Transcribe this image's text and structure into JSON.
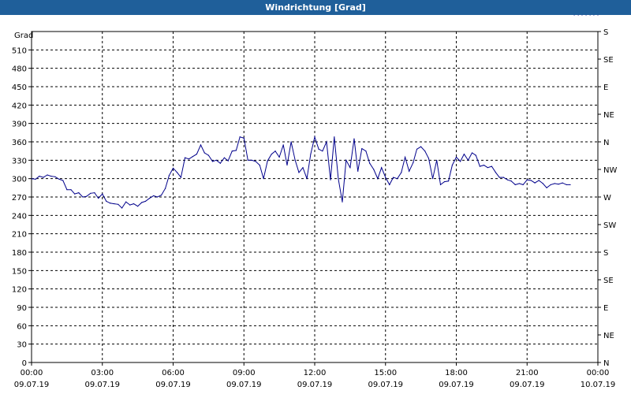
{
  "window": {
    "title": "Windrichtung [Grad]"
  },
  "chart_data": {
    "type": "line",
    "title": "Windrichtung [Grad]",
    "ylabel": "Grad",
    "ylim": [
      0,
      540
    ],
    "y_ticks": [
      0,
      30,
      60,
      90,
      120,
      150,
      180,
      210,
      240,
      270,
      300,
      330,
      360,
      390,
      420,
      450,
      480,
      510
    ],
    "y2_ticks": [
      {
        "value": 0,
        "label": "N"
      },
      {
        "value": 45,
        "label": "NE"
      },
      {
        "value": 90,
        "label": "E"
      },
      {
        "value": 135,
        "label": "SE"
      },
      {
        "value": 180,
        "label": "S"
      },
      {
        "value": 225,
        "label": "SW"
      },
      {
        "value": 270,
        "label": "W"
      },
      {
        "value": 315,
        "label": "NW"
      },
      {
        "value": 360,
        "label": "N"
      },
      {
        "value": 405,
        "label": "NE"
      },
      {
        "value": 450,
        "label": "E"
      },
      {
        "value": 495,
        "label": "SE"
      },
      {
        "value": 540,
        "label": "S"
      }
    ],
    "x_ticks": [
      {
        "time": "00:00",
        "date": "09.07.19"
      },
      {
        "time": "03:00",
        "date": "09.07.19"
      },
      {
        "time": "06:00",
        "date": "09.07.19"
      },
      {
        "time": "09:00",
        "date": "09.07.19"
      },
      {
        "time": "12:00",
        "date": "09.07.19"
      },
      {
        "time": "15:00",
        "date": "09.07.19"
      },
      {
        "time": "18:00",
        "date": "09.07.19"
      },
      {
        "time": "21:00",
        "date": "09.07.19"
      },
      {
        "time": "00:00",
        "date": "10.07.19"
      }
    ],
    "grid": true,
    "line_color": "#00008b",
    "series": [
      {
        "x_hours": [
          0,
          0.17,
          0.33,
          0.5,
          0.67,
          0.83,
          1,
          1.17,
          1.33,
          1.5,
          1.67,
          1.83,
          2,
          2.17,
          2.33,
          2.5,
          2.67,
          2.83,
          3,
          3.17,
          3.33,
          3.5,
          3.67,
          3.83,
          4,
          4.17,
          4.33,
          4.5,
          4.67,
          4.83,
          5,
          5.17,
          5.33,
          5.5,
          5.67,
          5.83,
          6,
          6.17,
          6.33,
          6.5,
          6.67,
          6.83,
          7,
          7.17,
          7.33,
          7.5,
          7.67,
          7.83,
          8,
          8.17,
          8.33,
          8.5,
          8.67,
          8.83,
          9,
          9.17,
          9.33,
          9.5,
          9.67,
          9.83,
          10,
          10.17,
          10.33,
          10.5,
          10.67,
          10.83,
          11,
          11.17,
          11.33,
          11.5,
          11.67,
          11.83,
          12,
          12.17,
          12.33,
          12.5,
          12.67,
          12.83,
          13,
          13.17,
          13.33,
          13.5,
          13.67,
          13.83,
          14,
          14.17,
          14.33,
          14.5,
          14.67,
          14.83,
          15,
          15.17,
          15.33,
          15.5,
          15.67,
          15.83,
          16,
          16.17,
          16.33,
          16.5,
          16.67,
          16.83,
          17,
          17.17,
          17.33,
          17.5,
          17.67,
          17.83,
          18,
          18.17,
          18.33,
          18.5,
          18.67,
          18.83,
          19,
          19.17,
          19.33,
          19.5,
          19.67,
          19.83,
          20,
          20.17,
          20.33,
          20.5,
          20.67,
          20.83,
          21,
          21.17,
          21.33,
          21.5,
          21.67,
          21.83,
          22,
          22.17,
          22.33,
          22.5,
          22.67,
          22.83,
          23,
          23.17,
          23.33,
          23.5,
          23.67,
          23.83,
          24
        ],
        "values": [
          300,
          299,
          304,
          302,
          306,
          304,
          303,
          299,
          297,
          282,
          282,
          275,
          277,
          270,
          271,
          276,
          277,
          268,
          275,
          263,
          260,
          259,
          258,
          252,
          262,
          257,
          259,
          255,
          261,
          263,
          268,
          272,
          270,
          273,
          284,
          305,
          317,
          310,
          302,
          334,
          332,
          336,
          340,
          355,
          342,
          338,
          328,
          330,
          325,
          334,
          329,
          345,
          346,
          368,
          366,
          330,
          330,
          328,
          322,
          300,
          329,
          340,
          345,
          335,
          355,
          322,
          360,
          330,
          310,
          318,
          300,
          340,
          368,
          348,
          345,
          360,
          298,
          368,
          300,
          262,
          330,
          318,
          365,
          312,
          349,
          345,
          325,
          315,
          300,
          318,
          302,
          290,
          302,
          300,
          310,
          335,
          312,
          326,
          348,
          352,
          345,
          333,
          300,
          330,
          290,
          295,
          296,
          322,
          335,
          328,
          340,
          330,
          342,
          338,
          320,
          322,
          318,
          320,
          310,
          302,
          302,
          298,
          296,
          290,
          292,
          290,
          298,
          297,
          293,
          297,
          292,
          285,
          290,
          292,
          291,
          293,
          290,
          290
        ]
      }
    ]
  }
}
